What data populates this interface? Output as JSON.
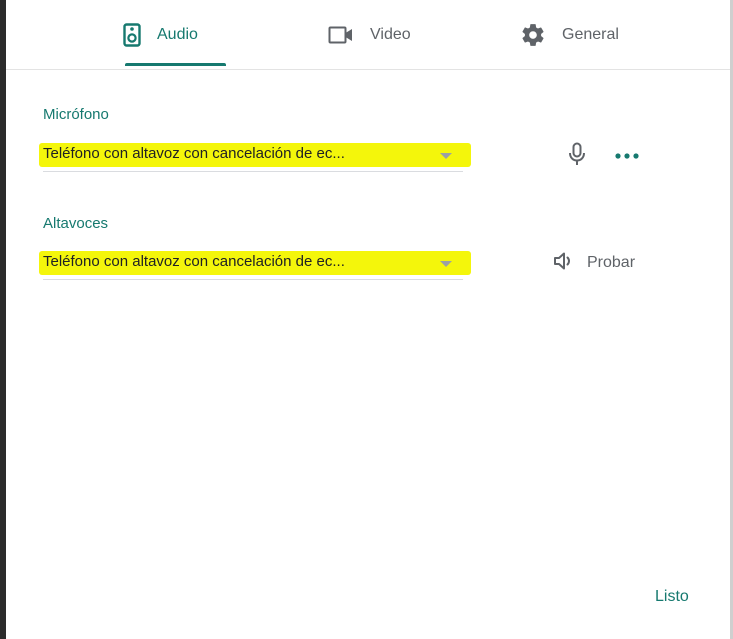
{
  "tabs": [
    {
      "label": "Audio",
      "icon": "speaker-icon",
      "active": true
    },
    {
      "label": "Video",
      "icon": "videocam-icon",
      "active": false
    },
    {
      "label": "General",
      "icon": "gear-icon",
      "active": false
    }
  ],
  "microphone": {
    "title": "Micrófono",
    "selected": "Teléfono con altavoz con cancelación de ec...",
    "icons": [
      "mic-icon",
      "more-options-icon"
    ]
  },
  "speakers": {
    "title": "Altavoces",
    "selected": "Teléfono con altavoz con cancelación de ec...",
    "test_label": "Probar",
    "test_icon": "volume-icon"
  },
  "footer": {
    "done_label": "Listo"
  },
  "colors": {
    "accent": "#16796f",
    "highlight": "#f4f60b",
    "text": "#202124",
    "muted": "#5f6368"
  }
}
